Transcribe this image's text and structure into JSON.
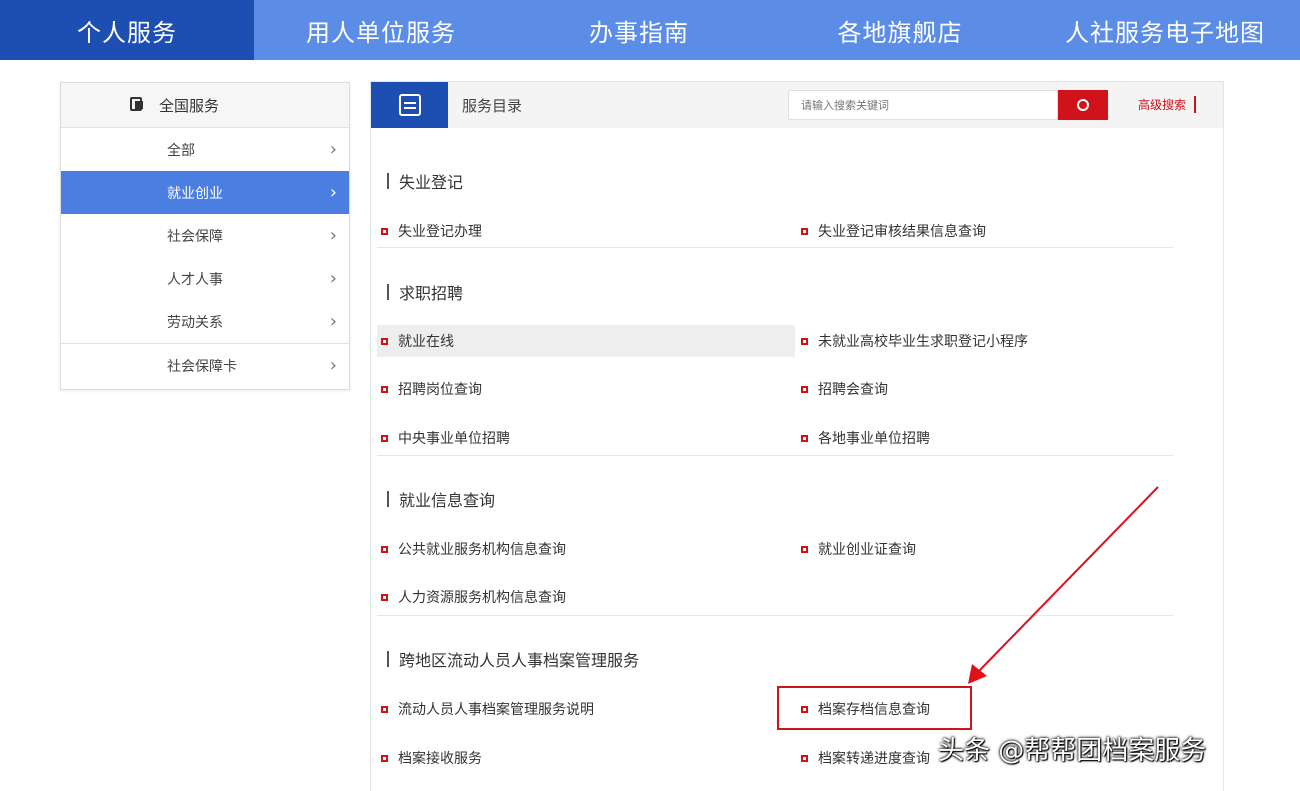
{
  "top_nav": [
    {
      "label": "个人服务",
      "active": true
    },
    {
      "label": "用人单位服务"
    },
    {
      "label": "办事指南"
    },
    {
      "label": "各地旗舰店"
    },
    {
      "label": "人社服务电子地图"
    }
  ],
  "sidebar": {
    "header": "全国服务",
    "items": [
      {
        "label": "全部"
      },
      {
        "label": "就业创业",
        "active": true
      },
      {
        "label": "社会保障"
      },
      {
        "label": "人才人事"
      },
      {
        "label": "劳动关系"
      },
      {
        "label": "社会保障卡"
      }
    ]
  },
  "panel": {
    "title": "服务目录",
    "search_placeholder": "请输入搜索关键词",
    "advanced_label": "高级搜索"
  },
  "sections": [
    {
      "title": "失业登记",
      "links": [
        "失业登记办理",
        "失业登记审核结果信息查询"
      ]
    },
    {
      "title": "求职招聘",
      "links": [
        "就业在线",
        "未就业高校毕业生求职登记小程序",
        "招聘岗位查询",
        "招聘会查询",
        "中央事业单位招聘",
        "各地事业单位招聘"
      ]
    },
    {
      "title": "就业信息查询",
      "links": [
        "公共就业服务机构信息查询",
        "就业创业证查询",
        "人力资源服务机构信息查询"
      ]
    },
    {
      "title": "跨地区流动人员人事档案管理服务",
      "links": [
        "流动人员人事档案管理服务说明",
        "档案存档信息查询",
        "档案接收服务",
        "档案转递进度查询"
      ]
    }
  ],
  "watermark": "头条 @帮帮团档案服务",
  "colors": {
    "nav_bg": "#5b8de6",
    "nav_active": "#1d4fb2",
    "accent_red": "#d0121b",
    "sidebar_active": "#4a7ee0"
  },
  "icons": [
    "search-icon",
    "document-icon",
    "chevron-right-icon",
    "service-icon"
  ]
}
